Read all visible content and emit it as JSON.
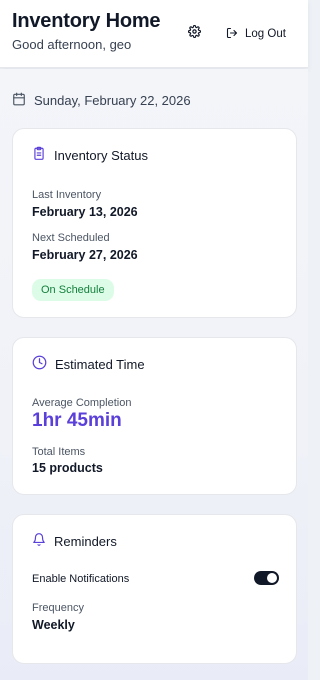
{
  "header": {
    "title": "Inventory Home",
    "greeting": "Good afternoon, geo",
    "settings_icon": "gear-icon",
    "logout_label": "Log Out",
    "logout_icon": "logout-icon"
  },
  "date_row": {
    "icon": "calendar-icon",
    "date": "Sunday, February 22, 2026"
  },
  "inventory_status": {
    "title": "Inventory Status",
    "icon": "clipboard-icon",
    "last_label": "Last Inventory",
    "last_value": "February 13, 2026",
    "next_label": "Next Scheduled",
    "next_value": "February 27, 2026",
    "badge": "On Schedule"
  },
  "estimated_time": {
    "title": "Estimated Time",
    "icon": "clock-icon",
    "avg_label": "Average Completion",
    "avg_value": "1hr 45min",
    "total_label": "Total Items",
    "total_value": "15 products"
  },
  "reminders": {
    "title": "Reminders",
    "icon": "bell-icon",
    "notifications_label": "Enable Notifications",
    "notifications_enabled": true,
    "frequency_label": "Frequency",
    "frequency_value": "Weekly"
  },
  "colors": {
    "accent": "#5b3fd9",
    "badge_bg": "#dcfce7",
    "badge_text": "#15803d",
    "toggle_on": "#111827"
  }
}
